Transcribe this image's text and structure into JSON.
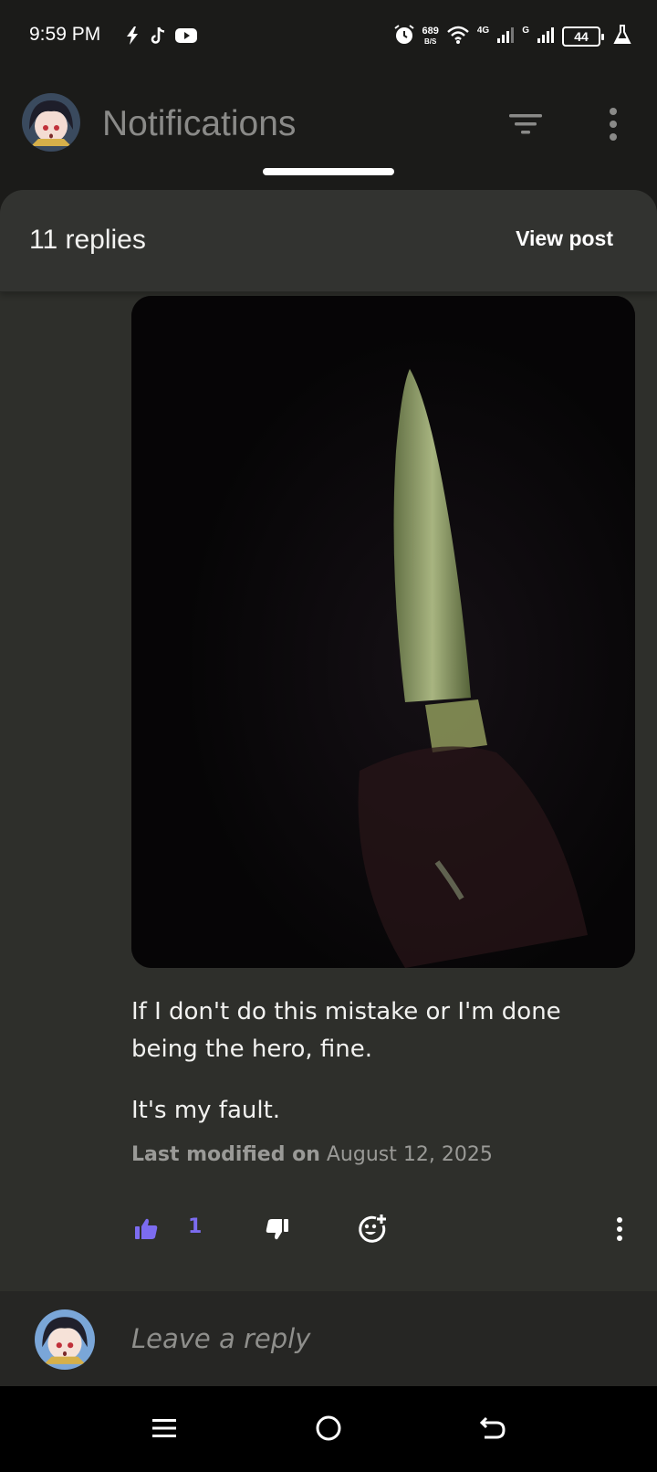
{
  "status_bar": {
    "time": "9:59 PM",
    "net_speed_value": "689",
    "net_speed_unit": "B/S",
    "signal1_label": "4G",
    "signal2_label": "G",
    "battery": "44",
    "left_icons": [
      "bolt-icon",
      "tiktok-icon",
      "youtube-icon"
    ],
    "right_icons": [
      "alarm-icon",
      "wifi-icon",
      "signal-icon",
      "battery-icon",
      "flask-icon"
    ]
  },
  "header": {
    "title": "Notifications",
    "icons": [
      "avatar",
      "filter-icon",
      "more-vert-icon"
    ]
  },
  "sheet": {
    "replies_count": "11 replies",
    "view_post_label": "View post"
  },
  "post": {
    "paragraph1": "If I don't do this mistake or I'm done being the hero, fine.",
    "paragraph2": "It's my fault.",
    "modified_label": "Last modified on",
    "modified_date": "August 12, 2025",
    "like_count": "1"
  },
  "actions": {
    "icons": [
      "thumbs-up-icon",
      "thumbs-down-icon",
      "emoji-add-icon",
      "more-vert-icon"
    ]
  },
  "reply": {
    "placeholder": "Leave a reply"
  },
  "navbar": {
    "icons": [
      "menu-icon",
      "home-circle-icon",
      "back-icon"
    ]
  },
  "colors": {
    "accent": "#7c6cf0",
    "background": "#1b1b19",
    "sheet": "#2e2f2b"
  }
}
